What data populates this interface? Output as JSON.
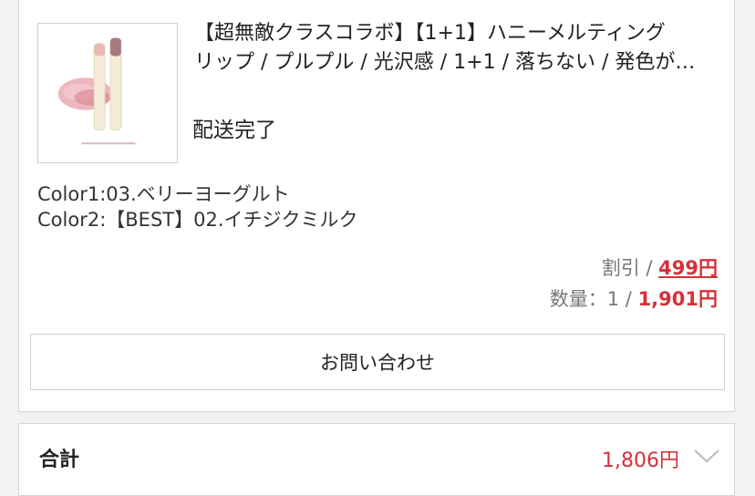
{
  "item": {
    "title_line1": "【超無敵クラスコラボ】【1+1】ハニーメルティング",
    "title_line2": "リップ / プルプル / 光沢感 / 1+1 / 落ちない / 発色が…",
    "status": "配送完了",
    "options": [
      "Color1:03.ベリーヨーグルト",
      "Color2:【BEST】02.イチジクミルク"
    ],
    "discount_label": "割引 / ",
    "discount_value": "499円",
    "qty_label": "数量：1 / ",
    "qty_price": "1,901円",
    "contact_button": "お問い合わせ"
  },
  "summary": {
    "total_label": "合計",
    "total_value": "1,806円",
    "expand_icon": "chevron-down-icon"
  },
  "colors": {
    "accent_red": "#d6303a",
    "swatch_pink": "#e8a0ab"
  }
}
